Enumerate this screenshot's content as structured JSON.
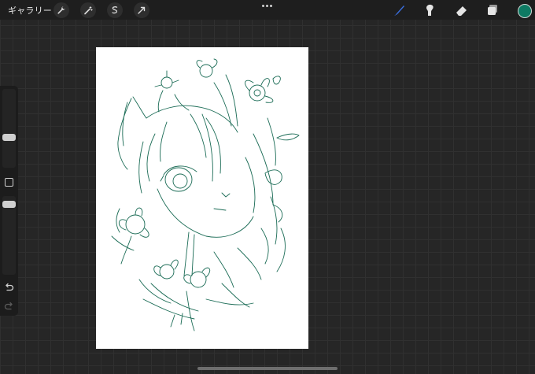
{
  "topbar": {
    "gallery_label": "ギャラリー",
    "left_tools": [
      "wrench-icon",
      "magic-wand-icon",
      "selection-icon",
      "transform-arrow-icon"
    ],
    "right_tools": [
      "brush-icon",
      "smudge-icon",
      "eraser-icon",
      "layers-icon"
    ],
    "brush_active_color": "#3a6fe0",
    "current_color": "#0e7a63"
  },
  "sidebar": {
    "brush_size_level": 0.5,
    "opacity_level": 0.4,
    "controls": [
      "brush-size-slider",
      "modify-button",
      "opacity-slider",
      "undo-icon",
      "redo-icon"
    ]
  },
  "canvas": {
    "background": "#ffffff",
    "sketch_color": "#1a6b55"
  }
}
